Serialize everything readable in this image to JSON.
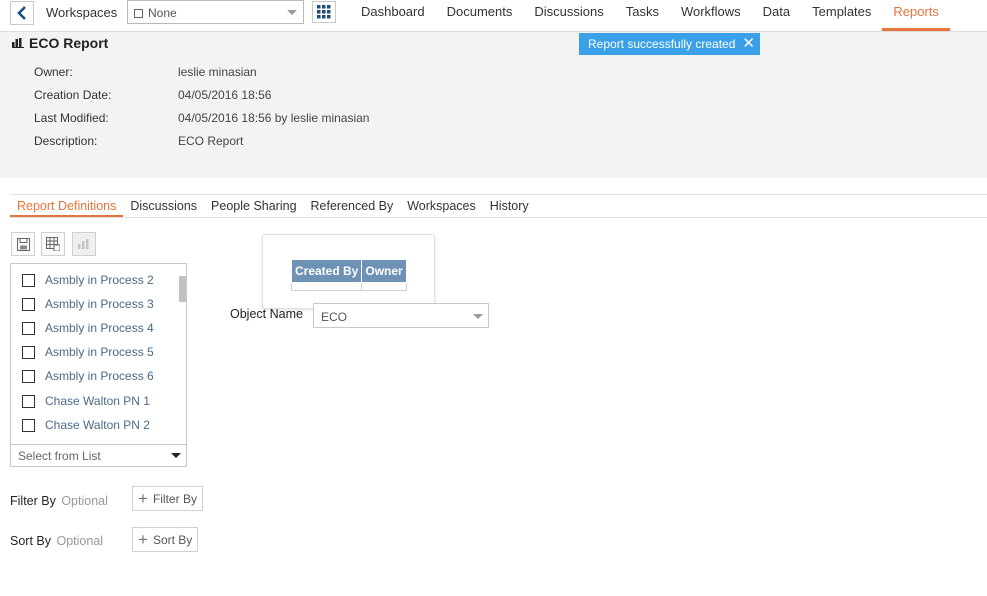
{
  "nav": {
    "workspaces_label": "Workspaces",
    "workspace_select_value": "None",
    "links": [
      "Dashboard",
      "Documents",
      "Discussions",
      "Tasks",
      "Workflows",
      "Data",
      "Templates",
      "Reports"
    ],
    "active_link": "Reports"
  },
  "header": {
    "title": "ECO Report",
    "toast": "Report successfully created",
    "meta": [
      {
        "key": "Owner:",
        "value": "leslie minasian"
      },
      {
        "key": "Creation Date:",
        "value": "04/05/2016 18:56"
      },
      {
        "key": "Last Modified:",
        "value": "04/05/2016 18:56 by leslie minasian"
      },
      {
        "key": "Description:",
        "value": "ECO Report"
      }
    ]
  },
  "tabs": [
    "Report Definitions",
    "Discussions",
    "People Sharing",
    "Referenced By",
    "Workspaces",
    "History"
  ],
  "field_list": {
    "items": [
      "Asmbly in Process 2",
      "Asmbly in Process 3",
      "Asmbly in Process 4",
      "Asmbly in Process 5",
      "Asmbly in Process 6",
      "Chase Walton PN 1",
      "Chase Walton PN 2"
    ],
    "select_placeholder": "Select from List"
  },
  "columns_preview": [
    "Created By",
    "Owner"
  ],
  "object": {
    "label": "Object Name",
    "value": "ECO"
  },
  "filter": {
    "label": "Filter By",
    "optional": "Optional",
    "button": "Filter By"
  },
  "sort": {
    "label": "Sort By",
    "optional": "Optional",
    "button": "Sort By"
  },
  "colors": {
    "accent": "#e8743b",
    "toast": "#3aa0e8",
    "table_header": "#6e92b5"
  }
}
